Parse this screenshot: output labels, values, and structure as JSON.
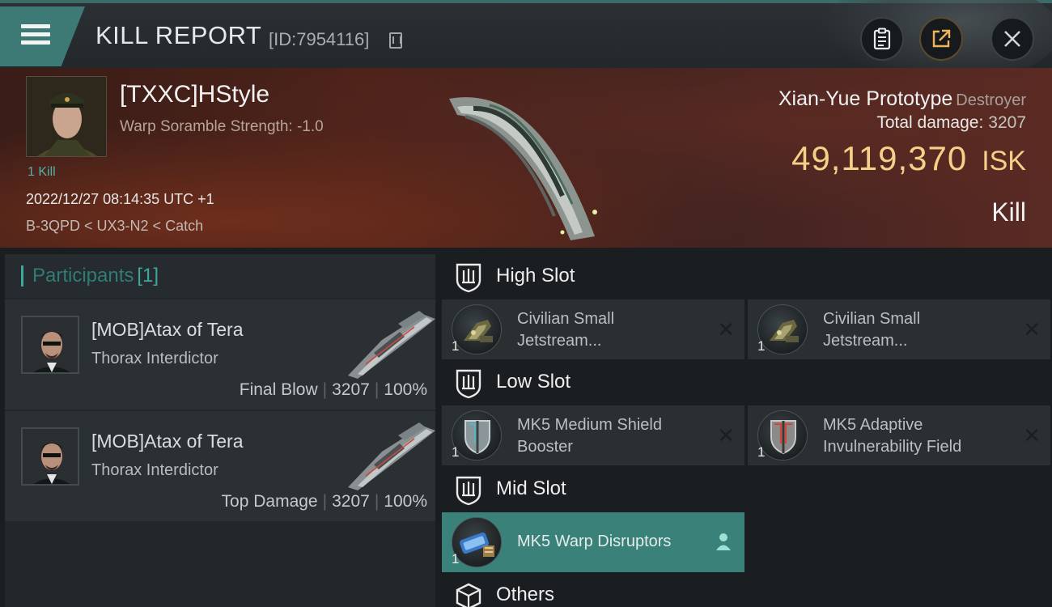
{
  "header": {
    "title": "KILL REPORT",
    "report_id": "[ID:7954116]",
    "buttons": [
      "clipboard",
      "share",
      "close"
    ]
  },
  "victim": {
    "name": "[TXXC]HStyle",
    "subtitle": "Warp Soramble Strength: -1.0",
    "kill_count": "1 Kill",
    "timestamp": "2022/12/27 08:14:35 UTC +1",
    "location": "B-3QPD < UX3-N2 < Catch",
    "ship_name": "Xian-Yue Prototype",
    "ship_class": "Destroyer",
    "damage_label": "Total damage:",
    "damage_value": "3207",
    "isk_value": "49,119,370",
    "isk_unit": "ISK",
    "result": "Kill"
  },
  "participants": {
    "label": "Participants",
    "count": "[1]",
    "rows": [
      {
        "name": "[MOB]Atax of Tera",
        "ship": "Thorax Interdictor",
        "role": "Final Blow",
        "damage": "3207",
        "percent": "100%"
      },
      {
        "name": "[MOB]Atax of Tera",
        "ship": "Thorax Interdictor",
        "role": "Top Damage",
        "damage": "3207",
        "percent": "100%"
      }
    ]
  },
  "fitting": {
    "high_slot": {
      "label": "High Slot",
      "modules": [
        {
          "name_line1": "Civilian Small",
          "name_line2": "Jetstream...",
          "qty": "1"
        },
        {
          "name_line1": "Civilian Small",
          "name_line2": "Jetstream...",
          "qty": "1"
        }
      ]
    },
    "low_slot": {
      "label": "Low Slot",
      "modules": [
        {
          "name_line1": "MK5 Medium Shield",
          "name_line2": "Booster",
          "qty": "1"
        },
        {
          "name_line1": "MK5 Adaptive",
          "name_line2": "Invulnerability Field",
          "qty": "1"
        }
      ]
    },
    "mid_slot": {
      "label": "Mid Slot",
      "modules": [
        {
          "name": "MK5 Warp Disruptors",
          "qty": "1"
        }
      ]
    },
    "others": {
      "label": "Others"
    }
  },
  "colors": {
    "accent": "#3fa89c",
    "isk": "#f4d188",
    "active_module": "#3a817a"
  }
}
